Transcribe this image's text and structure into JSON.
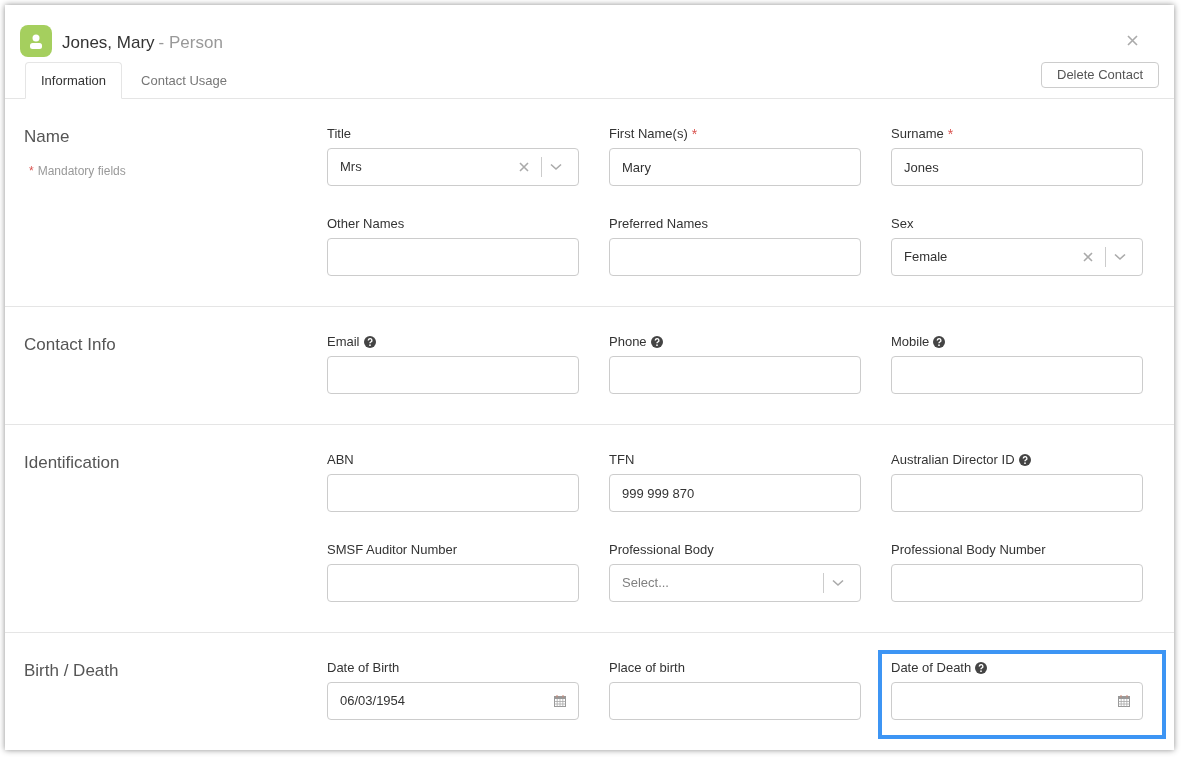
{
  "header": {
    "name": "Jones, Mary",
    "type": "- Person"
  },
  "tabs": [
    {
      "label": "Information",
      "selected": true
    },
    {
      "label": "Contact Usage",
      "selected": false
    }
  ],
  "delete_button": "Delete Contact",
  "sections": [
    {
      "title": "Name",
      "note": {
        "mark": "*",
        "text": "Mandatory fields"
      },
      "fields": [
        {
          "label": "Title",
          "kind": "select",
          "value": "Mrs",
          "clearable": true
        },
        {
          "label": "First Name(s)",
          "kind": "text",
          "value": "Mary",
          "required_mark": "*"
        },
        {
          "label": "Surname",
          "kind": "text",
          "value": "Jones",
          "required_mark": "*"
        },
        {
          "label": "Other Names",
          "kind": "text"
        },
        {
          "label": "Preferred Names",
          "kind": "text"
        },
        {
          "label": "Sex",
          "kind": "select",
          "value": "Female",
          "clearable": true
        }
      ]
    },
    {
      "title": "Contact Info",
      "fields": [
        {
          "label": "Email",
          "kind": "text",
          "help": true
        },
        {
          "label": "Phone",
          "kind": "text",
          "help": true
        },
        {
          "label": "Mobile",
          "kind": "text",
          "help": true
        }
      ]
    },
    {
      "title": "Identification",
      "fields": [
        {
          "label": "ABN",
          "kind": "text"
        },
        {
          "label": "TFN",
          "kind": "text",
          "value": "999 999 870"
        },
        {
          "label": "Australian Director ID",
          "kind": "text",
          "help": true
        },
        {
          "label": "SMSF Auditor Number",
          "kind": "text"
        },
        {
          "label": "Professional Body",
          "kind": "select",
          "placeholder": "Select..."
        },
        {
          "label": "Professional Body Number",
          "kind": "text"
        }
      ]
    },
    {
      "title": "Birth / Death",
      "fields": [
        {
          "label": "Date of Birth",
          "kind": "date",
          "value": "06/03/1954"
        },
        {
          "label": "Place of birth",
          "kind": "text"
        },
        {
          "label": "Date of Death",
          "kind": "date",
          "help": true,
          "highlighted": true
        }
      ]
    }
  ]
}
